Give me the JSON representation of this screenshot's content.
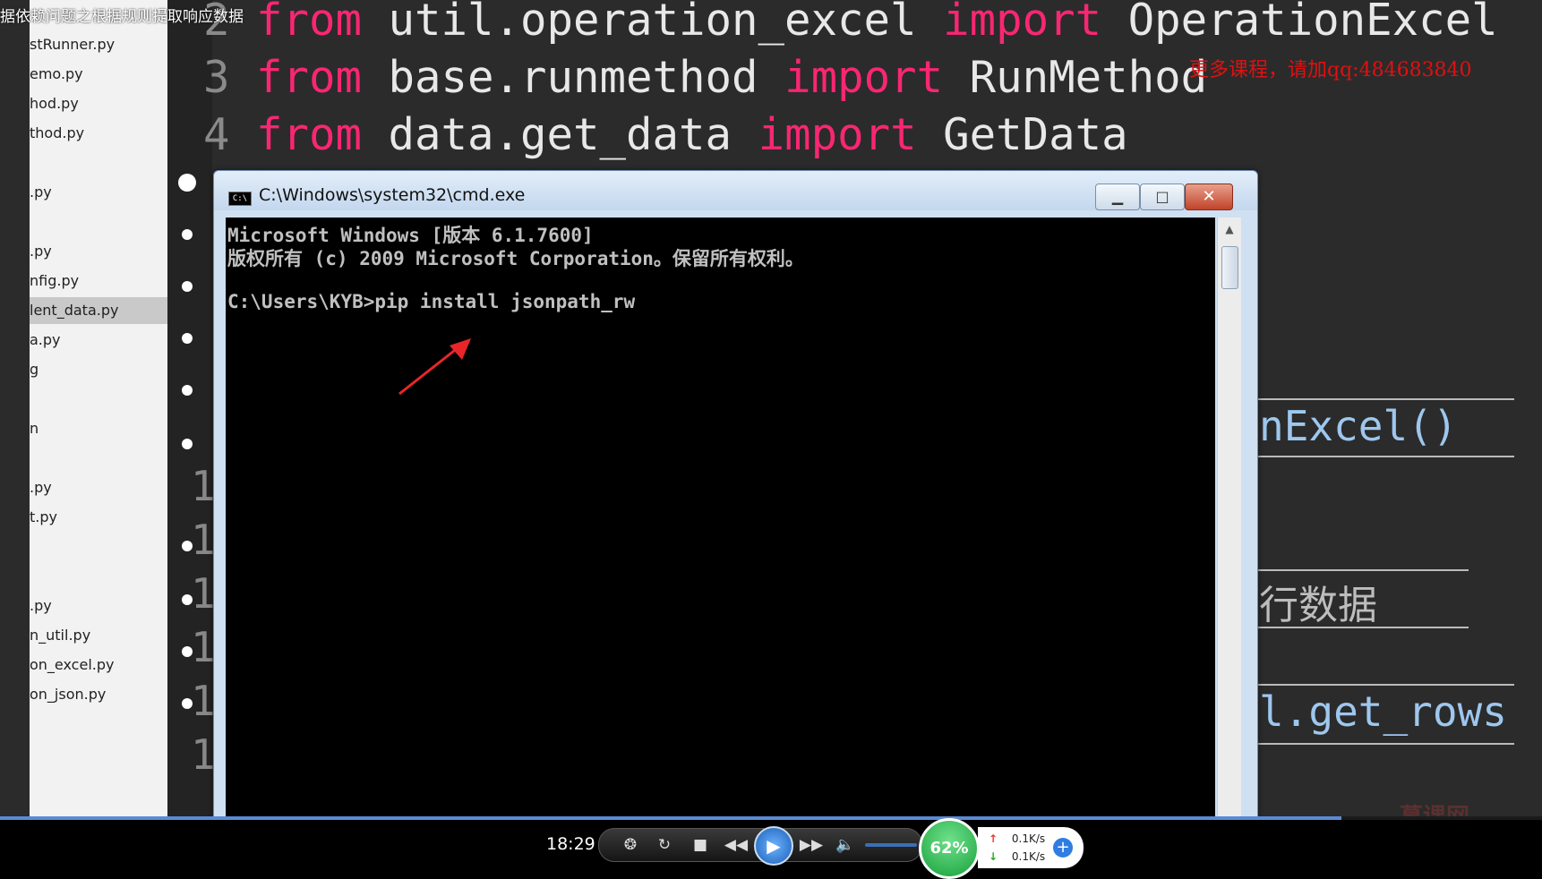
{
  "video": {
    "title": "据依赖问题之根据规则提取响应数据",
    "watermark": "更多课程，请加qq:484683840",
    "logo": "慕课网"
  },
  "file_tree": {
    "items": [
      {
        "label": "stRunner.py"
      },
      {
        "label": "emo.py"
      },
      {
        "label": "hod.py"
      },
      {
        "label": "thod.py"
      },
      {
        "label": ".py"
      },
      {
        "label": ".py"
      },
      {
        "label": "nfig.py"
      },
      {
        "label": "lent_data.py",
        "selected": true
      },
      {
        "label": "a.py"
      },
      {
        "label": "g"
      },
      {
        "label": "n"
      },
      {
        "label": ".py"
      },
      {
        "label": "t.py"
      },
      {
        "label": ".py"
      },
      {
        "label": "n_util.py"
      },
      {
        "label": "on_excel.py"
      },
      {
        "label": "on_json.py"
      }
    ]
  },
  "editor": {
    "lines": [
      {
        "num": "2",
        "parts": [
          {
            "t": "from",
            "k": true
          },
          {
            "t": " util.operation_excel "
          },
          {
            "t": "import",
            "k": true
          },
          {
            "t": " OperationExcel"
          }
        ]
      },
      {
        "num": "3",
        "parts": [
          {
            "t": "from",
            "k": true
          },
          {
            "t": " base.runmethod "
          },
          {
            "t": "import",
            "k": true
          },
          {
            "t": " RunMethod"
          }
        ]
      },
      {
        "num": "4",
        "parts": [
          {
            "t": "from",
            "k": true
          },
          {
            "t": " data.get_data "
          },
          {
            "t": "import",
            "k": true
          },
          {
            "t": " GetData"
          }
        ]
      }
    ],
    "gutter_digits": [
      "1",
      "1",
      "1",
      "1",
      "1",
      "1"
    ],
    "fragments": {
      "excel": "nExcel()",
      "row_data": "行数据",
      "get_rows": "l.get_rows"
    }
  },
  "cmd": {
    "title": "C:\\Windows\\system32\\cmd.exe",
    "icon_text": "C:\\",
    "lines": [
      "Microsoft Windows [版本 6.1.7600]",
      "版权所有 (c) 2009 Microsoft Corporation。保留所有权利。",
      "",
      "C:\\Users\\KYB>pip install jsonpath_rw"
    ]
  },
  "player": {
    "time": "18:29",
    "progress": 0.87,
    "speed": "62%",
    "upload": "0.1K/s",
    "download": "0.1K/s"
  }
}
